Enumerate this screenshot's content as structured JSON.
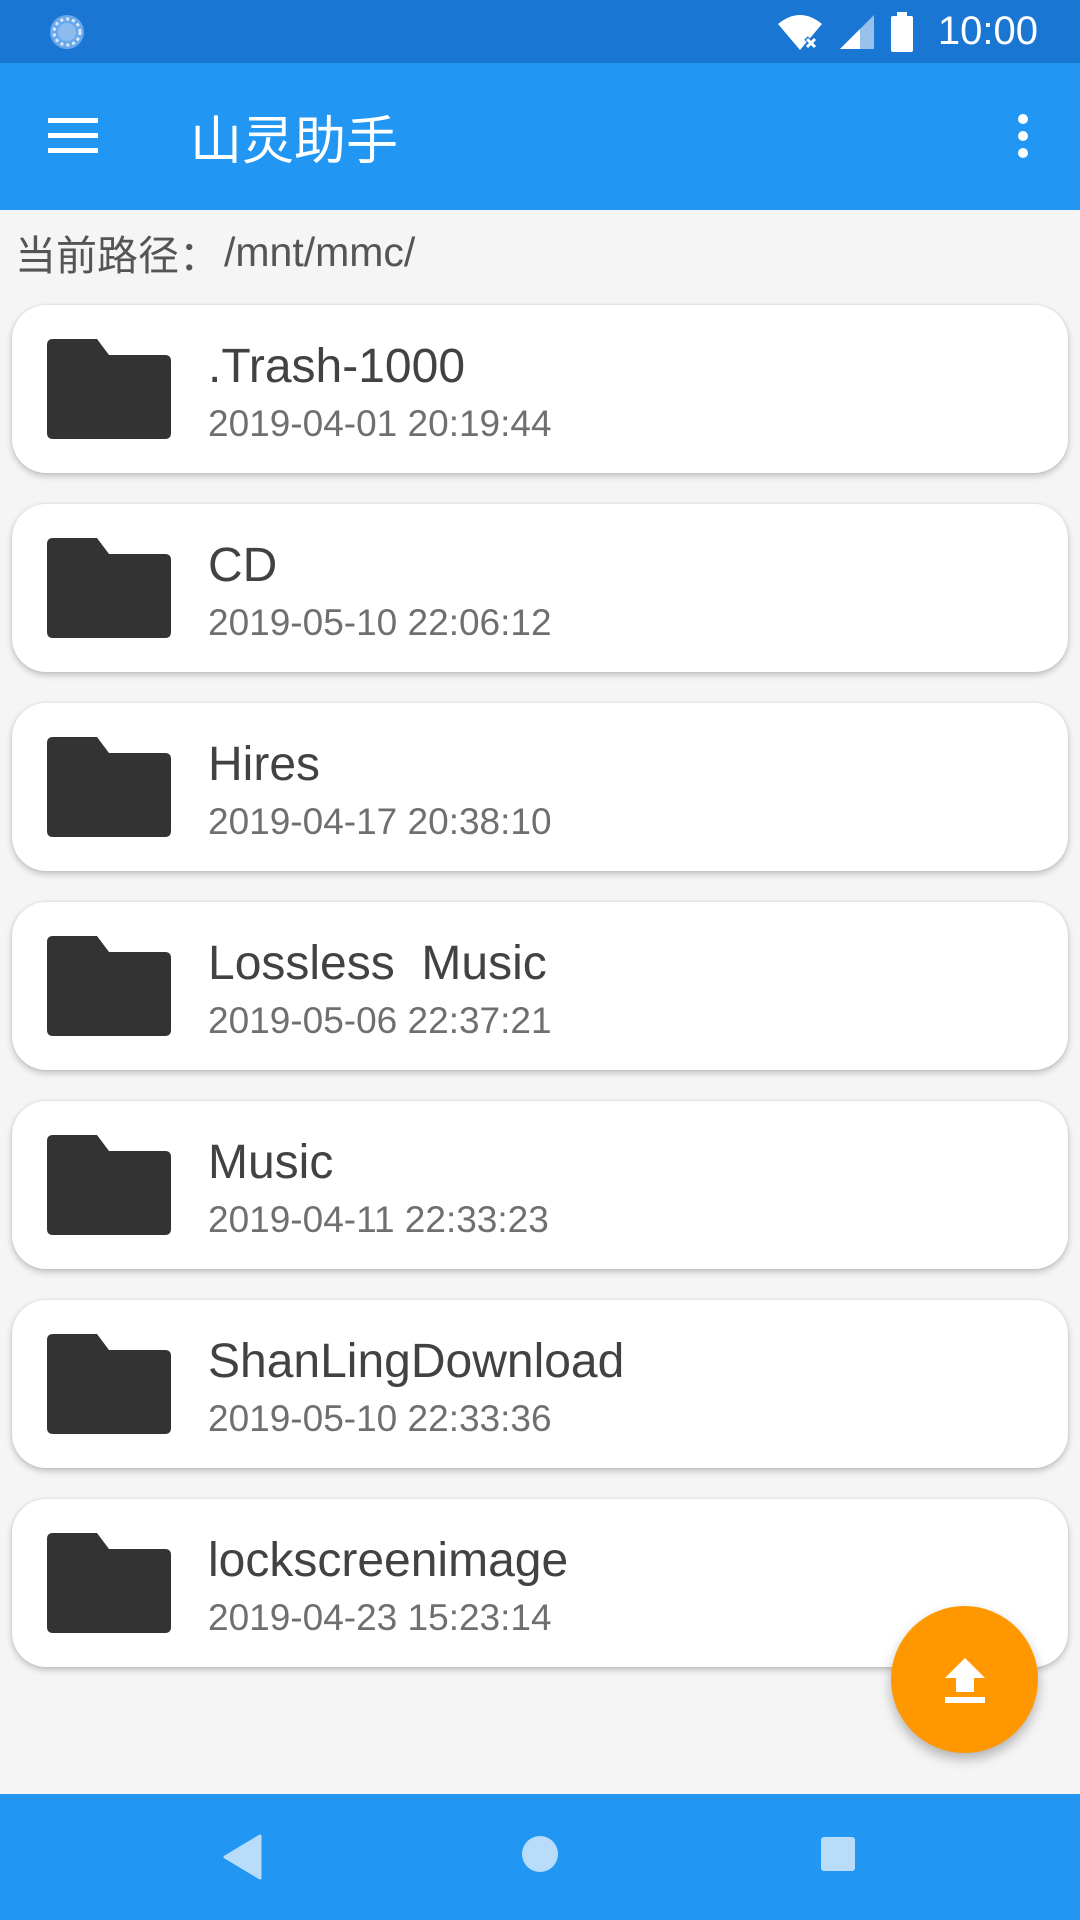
{
  "status_bar": {
    "time": "10:00",
    "icons": [
      "loading-spinner-icon",
      "wifi-off-icon",
      "cellular-signal-icon",
      "battery-icon"
    ]
  },
  "app_bar": {
    "title": "山灵助手",
    "menu_icon": "hamburger-menu-icon",
    "overflow_icon": "more-vert-icon"
  },
  "path": {
    "label": "当前路径：",
    "value": "/mnt/mmc/"
  },
  "files": [
    {
      "name": ".Trash-1000",
      "date": "2019-04-01 20:19:44",
      "icon": "folder-icon"
    },
    {
      "name": "CD",
      "date": "2019-05-10 22:06:12",
      "icon": "folder-icon"
    },
    {
      "name": "Hires",
      "date": "2019-04-17 20:38:10",
      "icon": "folder-icon"
    },
    {
      "name": "Lossless  Music",
      "date": "2019-05-06 22:37:21",
      "icon": "folder-icon"
    },
    {
      "name": "Music",
      "date": "2019-04-11 22:33:23",
      "icon": "folder-icon"
    },
    {
      "name": "ShanLingDownload",
      "date": "2019-05-10 22:33:36",
      "icon": "folder-icon"
    },
    {
      "name": "lockscreenimage",
      "date": "2019-04-23 15:23:14",
      "icon": "folder-icon"
    }
  ],
  "fab": {
    "icon": "upload-icon"
  },
  "nav_bar": {
    "icons": [
      "back-icon",
      "home-icon",
      "recents-icon"
    ]
  },
  "colors": {
    "status_bar": "#1976d2",
    "app_bar": "#2196f3",
    "fab": "#ff9800",
    "folder": "#333333"
  }
}
